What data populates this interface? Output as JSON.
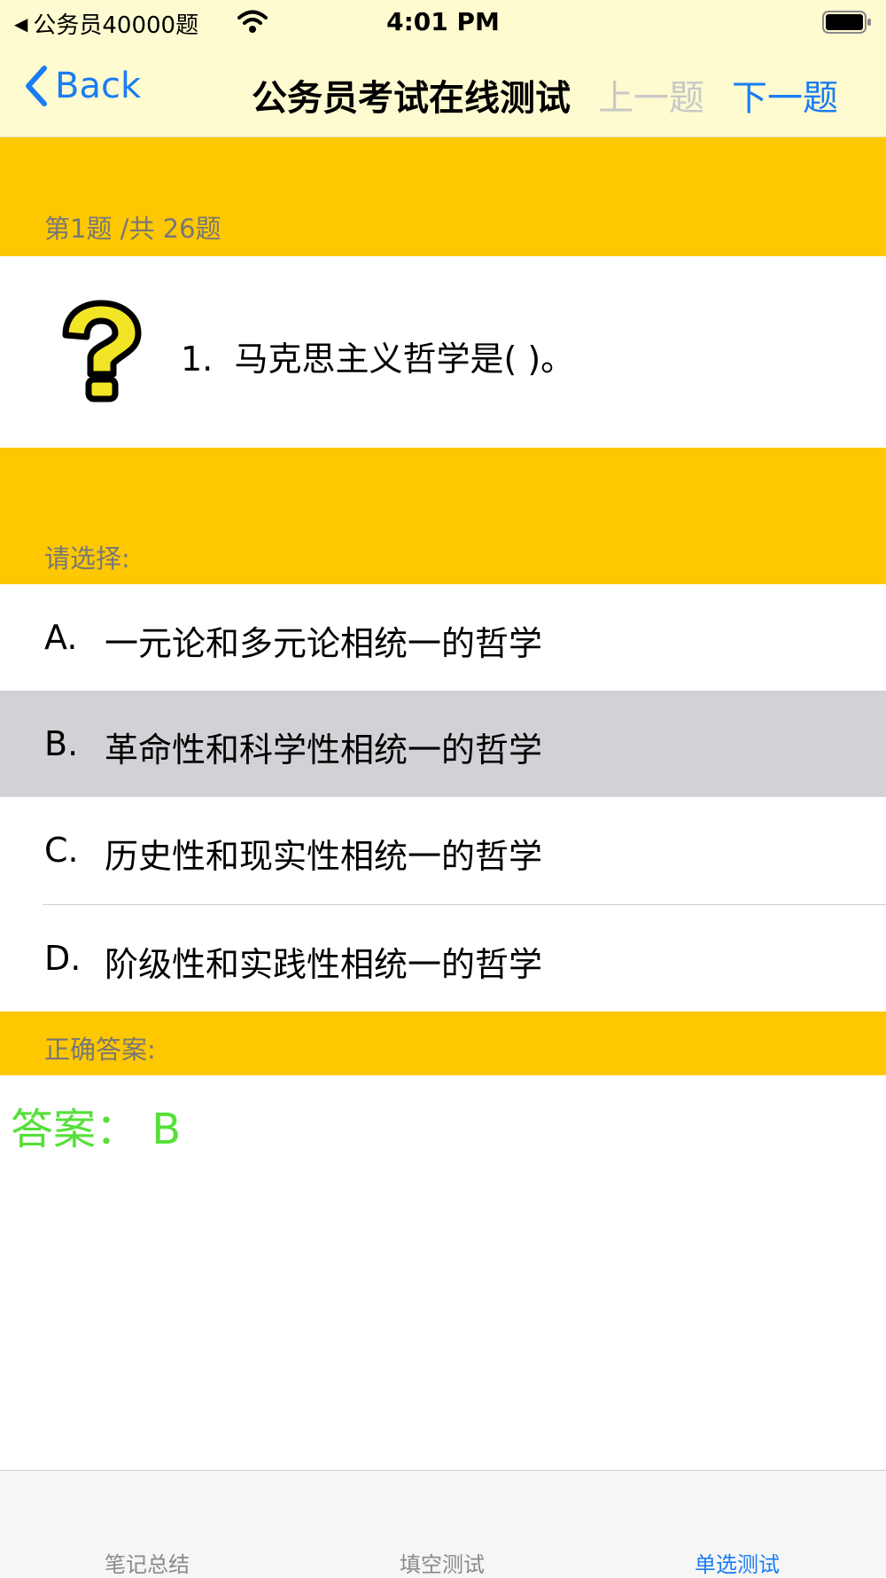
{
  "status_bar": {
    "back_app_label": "公务员40000题",
    "time": "4:01 PM"
  },
  "nav": {
    "back_label": "Back",
    "title": "公务员考试在线测试",
    "prev_label": "上一题",
    "next_label": "下一题"
  },
  "question": {
    "counter": "第1题 /共 26题",
    "number": "1.",
    "text": "马克思主义哲学是( )。"
  },
  "choices_header": "请选择:",
  "options": [
    {
      "letter": "A.",
      "text": "一元论和多元论相统一的哲学"
    },
    {
      "letter": "B.",
      "text": "革命性和科学性相统一的哲学"
    },
    {
      "letter": "C.",
      "text": "历史性和现实性相统一的哲学"
    },
    {
      "letter": "D.",
      "text": "阶级性和实践性相统一的哲学"
    }
  ],
  "selected_option": "B",
  "answer_header": "正确答案:",
  "answer_text": "答案： B",
  "tabs": [
    {
      "label": "笔记总结"
    },
    {
      "label": "填空测试"
    },
    {
      "label": "单选测试"
    }
  ],
  "active_tab": "单选测试",
  "colors": {
    "band": "#fdc800",
    "nav_background": "#fffbd0",
    "accent": "#1a7cf4",
    "answer": "#55e038",
    "selected_row": "#d2d2d6"
  }
}
